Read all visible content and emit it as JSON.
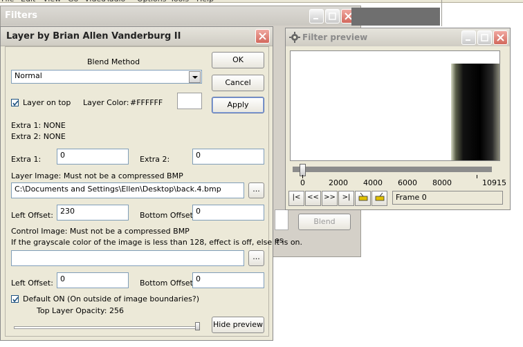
{
  "menubar": {
    "items": [
      "File",
      "Edit",
      "View",
      "Go",
      "Video",
      "Audio",
      "Options",
      "Tools",
      "Help"
    ]
  },
  "filters_window": {
    "title": "Filters",
    "blend_button": "Blend",
    "truncated_text": "es"
  },
  "layer_dialog": {
    "title": "Layer by Brian Allen Vanderburg II",
    "blend_method_label": "Blend Method",
    "blend_method_value": "Normal",
    "layer_on_top_label": "Layer on top",
    "layer_on_top_checked": true,
    "layer_color_label": "Layer Color:",
    "layer_color_value": "#FFFFFF",
    "extra1_info": "Extra 1:   NONE",
    "extra2_info": "Extra 2:   NONE",
    "extra1_label": "Extra 1:",
    "extra1_value": "0",
    "extra2_label": "Extra 2:",
    "extra2_value": "0",
    "layer_image_label": "Layer Image: Must not be a compressed BMP",
    "layer_image_path": "C:\\Documents and Settings\\Ellen\\Desktop\\back.4.bmp",
    "browse_label": "...",
    "left_offset_label": "Left Offset:",
    "left_offset_value": "230",
    "bottom_offset_label": "Bottom Offset:",
    "bottom_offset_value": "0",
    "control_image_label": "Control Image: Must not be a compressed BMP",
    "control_image_note": "If the grayscale color of the image is less than 128, effect is off, else it is on.",
    "control_image_path": "",
    "left_offset2_label": "Left Offset:",
    "left_offset2_value": "0",
    "bottom_offset2_label": "Bottom Offset:",
    "bottom_offset2_value": "0",
    "default_on_label": "Default ON (On outside of image boundaries?)",
    "default_on_checked": true,
    "opacity_label": "Top Layer Opacity:",
    "opacity_value": "256",
    "ok_label": "OK",
    "cancel_label": "Cancel",
    "apply_label": "Apply",
    "hide_preview_label": "Hide preview"
  },
  "preview_window": {
    "title": "Filter preview",
    "ticks": [
      "0",
      "2000",
      "4000",
      "6000",
      "8000",
      "10915"
    ],
    "frame_label": "Frame 0",
    "slider_position": 0
  },
  "colors": {
    "dialog_bg": "#ece9d8",
    "accent_border": "#7f9db9"
  }
}
